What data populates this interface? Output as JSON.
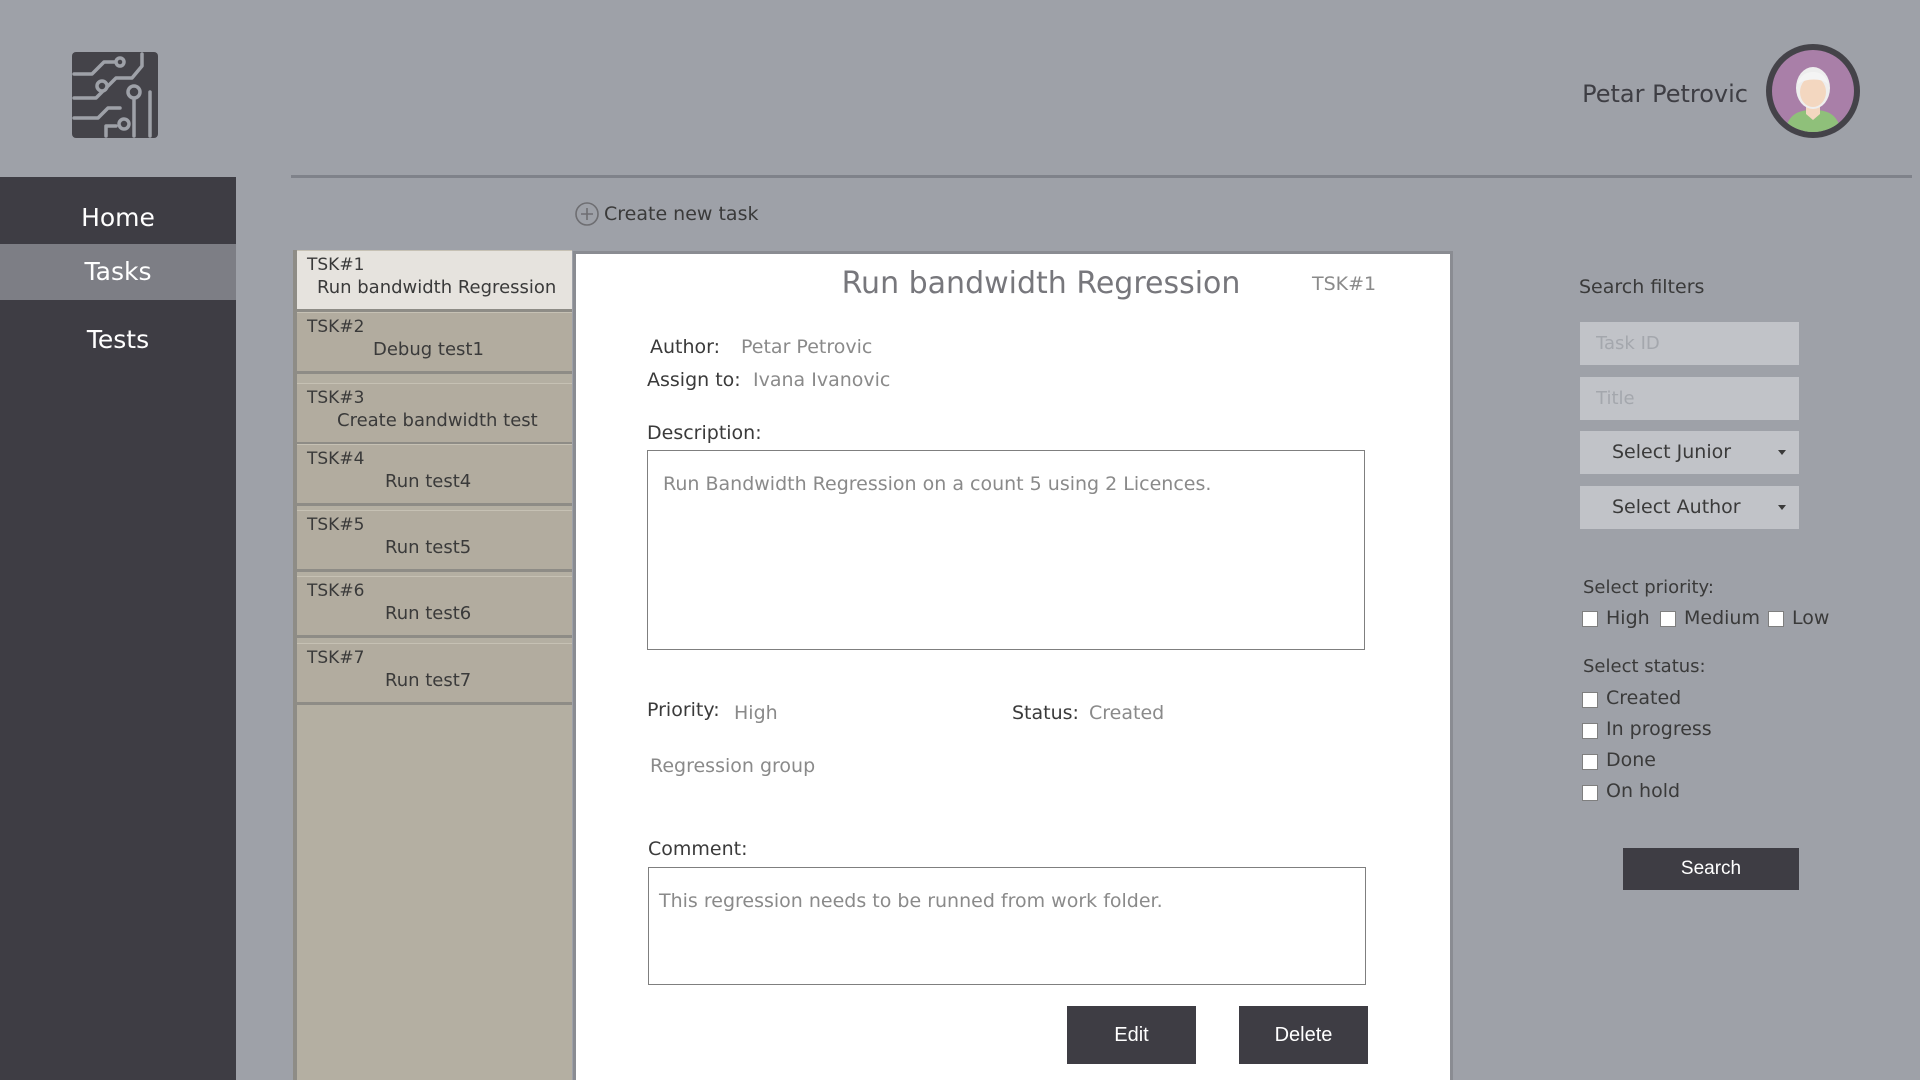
{
  "header": {
    "user_name": "Petar Petrovic"
  },
  "sidebar": {
    "items": [
      {
        "label": "Home",
        "active": false
      },
      {
        "label": "Tasks",
        "active": true
      },
      {
        "label": "Tests",
        "active": false
      }
    ]
  },
  "toolbar": {
    "create_task_label": "Create new task",
    "create_icon": "plus-circle-icon"
  },
  "tasks": [
    {
      "id": "TSK#1",
      "title": "Run bandwidth Regression",
      "selected": true
    },
    {
      "id": "TSK#2",
      "title": "Debug test1"
    },
    {
      "id": "TSK#3",
      "title": "Create bandwidth test"
    },
    {
      "id": "TSK#4",
      "title": "Run test4"
    },
    {
      "id": "TSK#5",
      "title": "Run test5"
    },
    {
      "id": "TSK#6",
      "title": "Run test6"
    },
    {
      "id": "TSK#7",
      "title": "Run test7"
    }
  ],
  "detail": {
    "title": "Run bandwidth Regression",
    "task_id": "TSK#1",
    "author_label": "Author:",
    "author": "Petar Petrovic",
    "assign_label": "Assign to:",
    "assignee": "Ivana Ivanovic",
    "description_label": "Description:",
    "description": "Run Bandwidth Regression on a count 5 using 2 Licences.",
    "priority_label": "Priority:",
    "priority": "High",
    "status_label": "Status:",
    "status": "Created",
    "group": "Regression group",
    "comment_label": "Comment:",
    "comment": "This regression needs to be runned from work folder.",
    "edit_label": "Edit",
    "delete_label": "Delete"
  },
  "filters": {
    "title": "Search filters",
    "task_id_placeholder": "Task ID",
    "title_placeholder": "Title",
    "junior_select": "Select Junior",
    "author_select": "Select Author",
    "priority_label": "Select priority:",
    "priority_options": [
      "High",
      "Medium",
      "Low"
    ],
    "status_label": "Select status:",
    "status_options": [
      "Created",
      "In progress",
      "Done",
      "On hold"
    ],
    "search_label": "Search"
  },
  "colors": {
    "background": "#9ea1a8",
    "sidebar": "#3e3d44",
    "accent_dark": "#3e3d44",
    "task_list": "#b4afa2"
  }
}
